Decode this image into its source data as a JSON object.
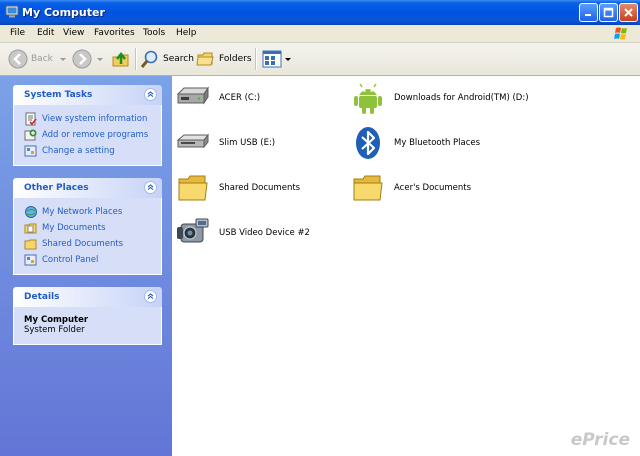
{
  "window": {
    "title": "My Computer"
  },
  "menu": [
    "File",
    "Edit",
    "View",
    "Favorites",
    "Tools",
    "Help"
  ],
  "toolbar": {
    "back": "Back",
    "search": "Search",
    "folders": "Folders"
  },
  "left": {
    "system_tasks": {
      "title": "System Tasks",
      "items": [
        "View system information",
        "Add or remove programs",
        "Change a setting"
      ]
    },
    "other_places": {
      "title": "Other Places",
      "items": [
        "My Network Places",
        "My Documents",
        "Shared Documents",
        "Control Panel"
      ]
    },
    "details": {
      "title": "Details",
      "name": "My Computer",
      "type": "System Folder"
    }
  },
  "items": [
    {
      "label": "ACER (C:)",
      "icon": "hard-drive-icon"
    },
    {
      "label": "Downloads for Android(TM) (D:)",
      "icon": "android-icon"
    },
    {
      "label": "Slim USB (E:)",
      "icon": "removable-drive-icon"
    },
    {
      "label": "My Bluetooth Places",
      "icon": "bluetooth-icon"
    },
    {
      "label": "Shared Documents",
      "icon": "folder-icon"
    },
    {
      "label": "Acer's Documents",
      "icon": "folder-icon"
    },
    {
      "label": "USB Video Device #2",
      "icon": "camcorder-icon"
    }
  ],
  "watermark": "ePrice",
  "colors": {
    "title_bar": "#0054e3",
    "task_link": "#215dc6",
    "left_pane": "#7ba2e7"
  }
}
